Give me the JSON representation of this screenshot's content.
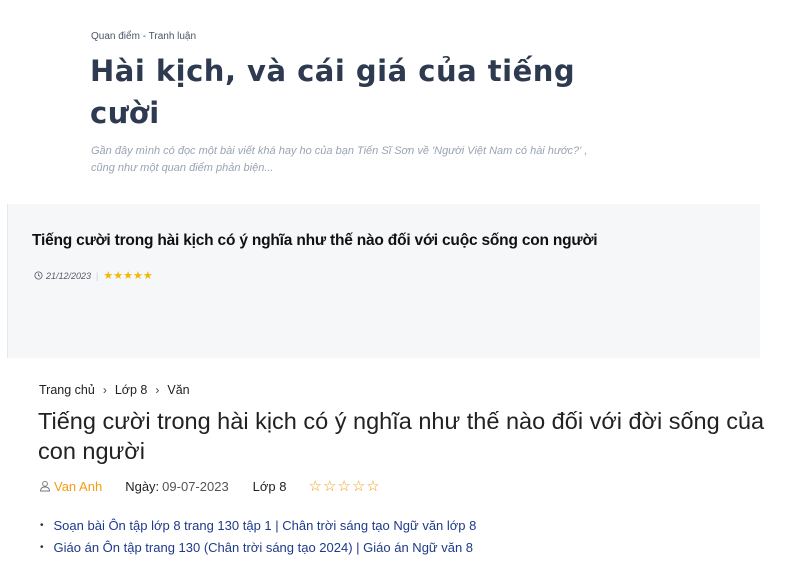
{
  "section1": {
    "category": "Quan điểm - Tranh luận",
    "title": "Hài kịch, và cái giá của tiếng cười",
    "excerpt": "Gần đây mình có đọc một bài viết khá hay ho của bạn Tiến Sĩ Sơn về 'Người Việt Nam có hài hước?' , cũng như một quan điểm phản biện..."
  },
  "section2": {
    "title": "Tiếng cười trong hài kịch có ý nghĩa như thế nào đối với cuộc sống con người",
    "date": "21/12/2023",
    "separator": "|",
    "stars": "★★★★★",
    "rating": 5,
    "icon": "clock-icon"
  },
  "section3": {
    "breadcrumb": [
      "Trang chủ",
      "Lớp 8",
      "Văn"
    ],
    "breadcrumb_separator": "›",
    "title": "Tiếng cười trong hài kịch có ý nghĩa như thế nào đối với đời sống của con người",
    "author": "Van Anh",
    "date_label": "Ngày:",
    "date": "09-07-2023",
    "grade": "Lớp 8",
    "stars": "☆☆☆☆☆",
    "rating": 0,
    "links": [
      "Soạn bài Ôn tập lớp 8 trang 130 tập 1 | Chân trời sáng tạo Ngữ văn lớp 8",
      "Giáo án Ôn tập trang 130 (Chân trời sáng tạo 2024) | Giáo án Ngữ văn 8"
    ],
    "bullet": "•"
  },
  "colors": {
    "title_dark": "#2d3a4f",
    "excerpt_gray": "#9aa3b2",
    "star_gold": "#f2b705",
    "author_orange": "#f39c12",
    "link_blue": "#1e3a8a"
  }
}
